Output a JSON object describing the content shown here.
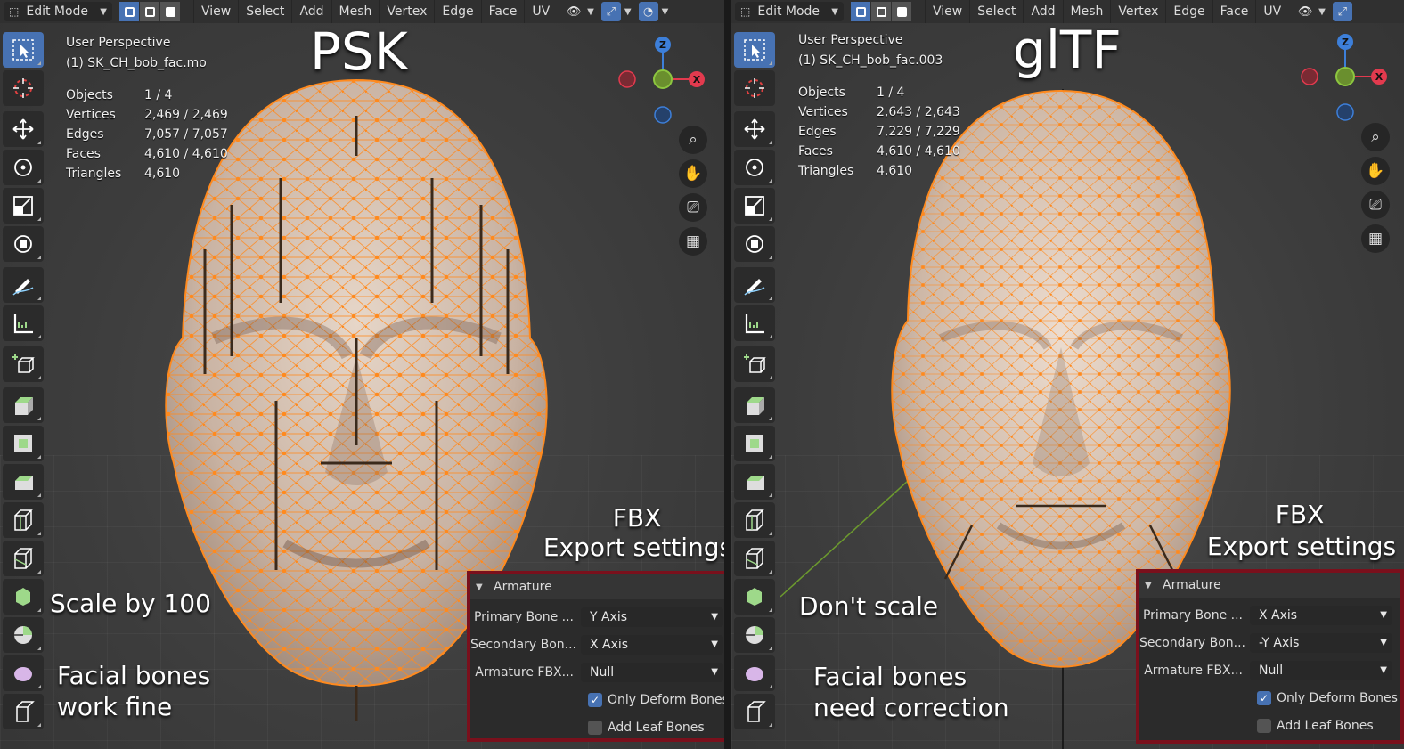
{
  "left": {
    "header": {
      "mode": "Edit Mode",
      "menus": [
        "View",
        "Select",
        "Add",
        "Mesh",
        "Vertex",
        "Edge",
        "Face",
        "UV"
      ]
    },
    "overlay": {
      "view_name": "User Perspective",
      "object_name": "(1) SK_CH_bob_fac.mo",
      "stats": [
        {
          "label": "Objects",
          "value": "1 / 4"
        },
        {
          "label": "Vertices",
          "value": "2,469 / 2,469"
        },
        {
          "label": "Edges",
          "value": "7,057 / 7,057"
        },
        {
          "label": "Faces",
          "value": "4,610 / 4,610"
        },
        {
          "label": "Triangles",
          "value": "4,610"
        }
      ]
    },
    "big_label": "PSK",
    "annotation_scale": "Scale by 100",
    "annotation_bones_1": "Facial bones",
    "annotation_bones_2": "work fine",
    "fbx_1": "FBX",
    "fbx_2": "Export settings",
    "panel": {
      "title": "Armature",
      "primary_label": "Primary Bone ...",
      "primary_value": "Y Axis",
      "secondary_label": "Secondary Bon...",
      "secondary_value": "X Axis",
      "node_label": "Armature FBX...",
      "node_value": "Null",
      "deform_label": "Only Deform Bones",
      "deform_checked": true,
      "leaf_label": "Add Leaf Bones",
      "leaf_checked": false
    }
  },
  "right": {
    "header": {
      "mode": "Edit Mode",
      "menus": [
        "View",
        "Select",
        "Add",
        "Mesh",
        "Vertex",
        "Edge",
        "Face",
        "UV"
      ]
    },
    "overlay": {
      "view_name": "User Perspective",
      "object_name": "(1) SK_CH_bob_fac.003",
      "stats": [
        {
          "label": "Objects",
          "value": "1 / 4"
        },
        {
          "label": "Vertices",
          "value": "2,643 / 2,643"
        },
        {
          "label": "Edges",
          "value": "7,229 / 7,229"
        },
        {
          "label": "Faces",
          "value": "4,610 / 4,610"
        },
        {
          "label": "Triangles",
          "value": "4,610"
        }
      ]
    },
    "big_label": "glTF",
    "annotation_scale": "Don't scale",
    "annotation_bones_1": "Facial bones",
    "annotation_bones_2": "need correction",
    "fbx_1": "FBX",
    "fbx_2": "Export settings",
    "panel": {
      "title": "Armature",
      "primary_label": "Primary Bone ...",
      "primary_value": "X Axis",
      "secondary_label": "Secondary Bon...",
      "secondary_value": "-Y Axis",
      "node_label": "Armature FBX...",
      "node_value": "Null",
      "deform_label": "Only Deform Bones",
      "deform_checked": true,
      "leaf_label": "Add Leaf Bones",
      "leaf_checked": false
    }
  },
  "gizmo": {
    "z": "Z",
    "x": "X"
  },
  "colors": {
    "accent": "#4772b3",
    "wire": "#ff8a1e",
    "panel_border": "#7a101c",
    "x_axis": "#e23a4e",
    "y_axis": "#8cc63f",
    "z_axis": "#3d7fd9"
  }
}
